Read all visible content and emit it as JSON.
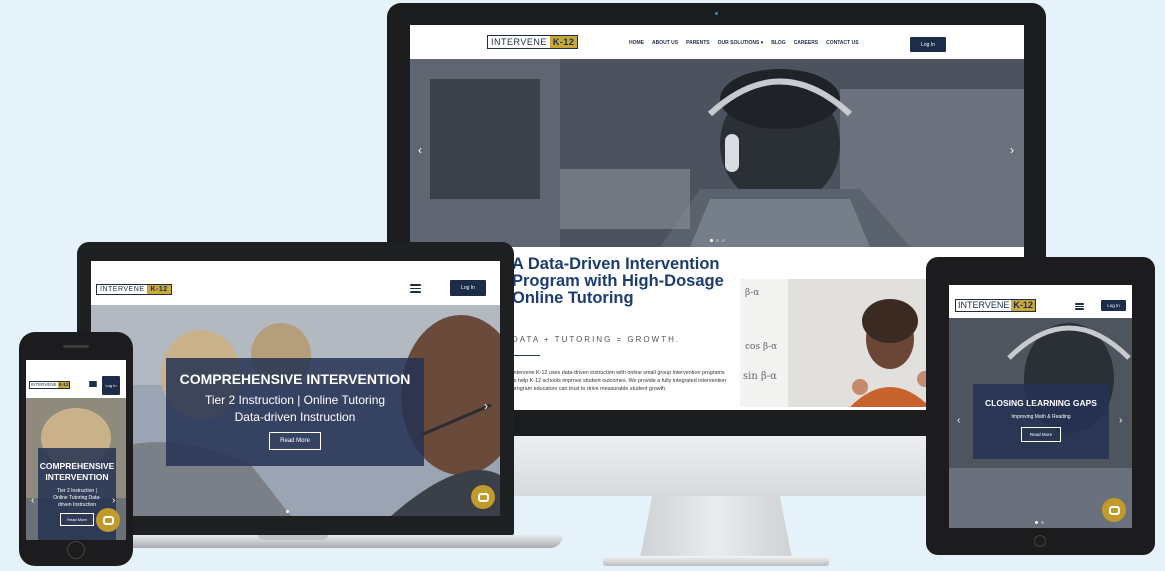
{
  "brand": {
    "logo_word": "INTERVENE",
    "logo_badge": "K-12",
    "gold": "#c8a83a",
    "navy": "#1d2c49"
  },
  "desktop": {
    "nav": [
      "HOME",
      "ABOUT US",
      "PARENTS",
      "OUR SOLUTIONS",
      "BLOG",
      "CAREERS",
      "CONTACT US"
    ],
    "dropdown_icon": "caret-down-icon",
    "login": "Log In",
    "headline": "A Data-Driven Intervention Program with High-Dosage Online Tutoring",
    "tagline": "DATA + TUTORING = GROWTH.",
    "paragraph": "Intervene K-12 uses data-driven instruction with online small group intervention programs to help K-12 schools improve student outcomes. We provide a fully integrated intervention program educators can trust to drive measurable student growth.",
    "prev": "‹",
    "next": "›"
  },
  "laptop": {
    "login": "Log In",
    "title": "COMPREHENSIVE INTERVENTION",
    "line1": "Tier 2 Instruction | Online Tutoring",
    "line2": "Data-driven Instruction",
    "cta": "Read More",
    "next": "›"
  },
  "phone": {
    "login": "Log In",
    "title": "COMPREHENSIVE INTERVENTION",
    "sub": "Tier 2 Instruction | Online Tutoring Data-driven Instruction",
    "cta": "Read More",
    "prev": "‹",
    "next": "›"
  },
  "tablet": {
    "login": "Log In",
    "title": "CLOSING LEARNING GAPS",
    "sub": "Improving Math & Reading",
    "cta": "Read More",
    "prev": "‹",
    "next": "›"
  },
  "colors": {
    "bg": "#e6f2fa",
    "headline": "#1d3c74",
    "chat": "#c29a2c"
  }
}
